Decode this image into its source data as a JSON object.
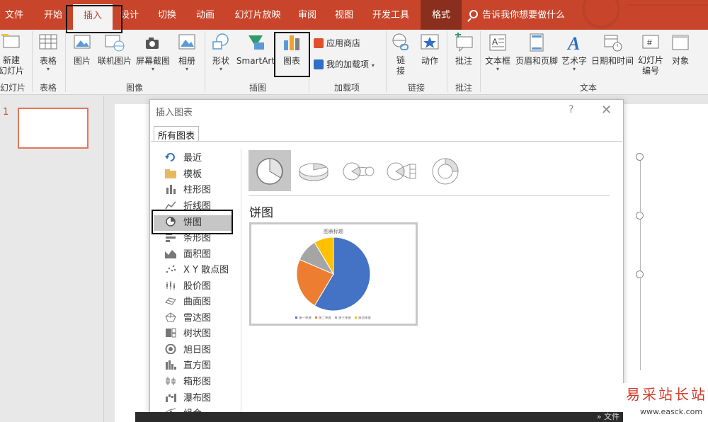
{
  "tabs": [
    "文件",
    "开始",
    "插入",
    "设计",
    "切换",
    "动画",
    "幻灯片放映",
    "审阅",
    "视图",
    "开发工具",
    "格式"
  ],
  "tell_me": "告诉我你想要做什么",
  "ribbon": {
    "new_slide": "新建\n幻灯片",
    "table": "表格",
    "picture": "图片",
    "online_picture": "联机图片",
    "screenshot": "屏幕截图",
    "album": "相册",
    "shapes": "形状",
    "smartart": "SmartArt",
    "chart": "图表",
    "store": "应用商店",
    "my_addins": "我的加载项",
    "link": "链\n接",
    "action": "动作",
    "comment": "批注",
    "textbox": "文本框",
    "header_footer": "页眉和页脚",
    "wordart": "艺术字",
    "datetime": "日期和时间",
    "slide_number": "幻灯片\n编号",
    "object": "对象",
    "groups": {
      "slides": "幻灯片",
      "tables": "表格",
      "images": "图像",
      "illustrations": "插图",
      "addins": "加载项",
      "links": "链接",
      "comments": "批注",
      "text": "文本"
    }
  },
  "thumbnail_number": "1",
  "dialog": {
    "title": "插入图表",
    "help": "?",
    "close": "✕",
    "tab": "所有图表",
    "categories": [
      "最近",
      "模板",
      "柱形图",
      "折线图",
      "饼图",
      "条形图",
      "面积图",
      "X Y 散点图",
      "股价图",
      "曲面图",
      "雷达图",
      "树状图",
      "旭日图",
      "直方图",
      "箱形图",
      "瀑布图",
      "组合"
    ],
    "selected_category": "饼图",
    "selected_heading": "饼图",
    "preview_title": "图表标题",
    "legend": [
      "第一季度",
      "第二季度",
      "第三季度",
      "第四季度"
    ]
  },
  "chart_data": {
    "type": "pie",
    "title": "图表标题",
    "categories": [
      "第一季度",
      "第二季度",
      "第三季度",
      "第四季度"
    ],
    "values": [
      8.2,
      3.2,
      1.4,
      1.2
    ],
    "colors": [
      "#4472c4",
      "#ed7d31",
      "#a5a5a5",
      "#ffc000"
    ]
  },
  "taskbar_text": "» 文件",
  "watermark": {
    "cn": "易采站长站",
    "url": "www.easck.com"
  }
}
